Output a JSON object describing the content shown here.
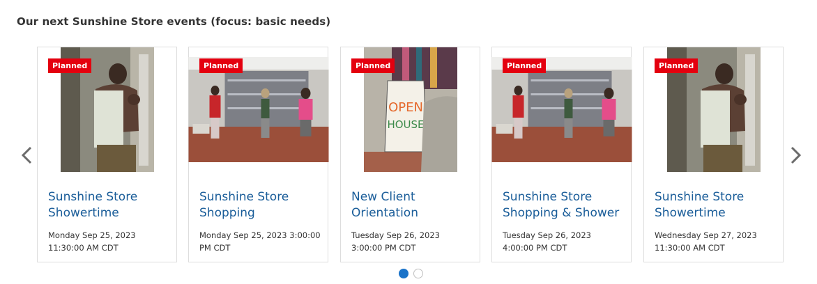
{
  "section": {
    "title": "Our next Sunshine Store events (focus: basic needs)"
  },
  "carousel": {
    "prev_icon": "chevron-left-icon",
    "next_icon": "chevron-right-icon",
    "active_page": 1,
    "page_count": 2,
    "events": [
      {
        "status": "Planned",
        "title": "Sunshine Store Showertime",
        "date": "Monday Sep 25, 2023 11:30:00 AM CDT",
        "image": "man-with-towel-photo"
      },
      {
        "status": "Planned",
        "title": "Sunshine Store Shopping",
        "date": "Monday Sep 25, 2023 3:00:00 PM CDT",
        "image": "store-shelves-shoppers-photo"
      },
      {
        "status": "Planned",
        "title": "New Client Orientation",
        "date": "Tuesday Sep 26, 2023 3:00:00 PM CDT",
        "image": "open-house-sign-photo"
      },
      {
        "status": "Planned",
        "title": "Sunshine Store Shopping & Shower",
        "date": "Tuesday Sep 26, 2023 4:00:00 PM CDT",
        "image": "store-shelves-shoppers-photo"
      },
      {
        "status": "Planned",
        "title": "Sunshine Store Showertime",
        "date": "Wednesday Sep 27, 2023 11:30:00 AM CDT",
        "image": "man-with-towel-photo"
      }
    ]
  },
  "colors": {
    "badge": "#e4000f",
    "title_link": "#1a5d99",
    "dot_active": "#1a73c9"
  }
}
